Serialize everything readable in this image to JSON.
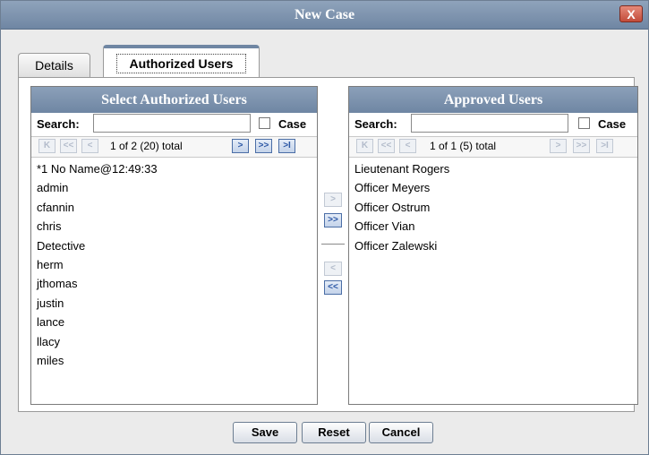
{
  "window": {
    "title": "New Case",
    "close_label": "X"
  },
  "tabs": [
    {
      "label": "Details",
      "active": false
    },
    {
      "label": "Authorized Users",
      "active": true
    }
  ],
  "left_list": {
    "header": "Select Authorized Users",
    "search_label": "Search:",
    "search_value": "",
    "case_label": "Case",
    "case_checked": false,
    "pager_text": "1 of 2 (20) total",
    "items": [
      "*1 No Name@12:49:33",
      "admin",
      "cfannin",
      "chris",
      "Detective",
      "herm",
      "jthomas",
      "justin",
      "lance",
      "llacy",
      "miles"
    ]
  },
  "right_list": {
    "header": "Approved Users",
    "search_label": "Search:",
    "search_value": "",
    "case_label": "Case",
    "case_checked": false,
    "pager_text": "1 of 1 (5) total",
    "items": [
      "Lieutenant Rogers",
      "Officer Meyers",
      "Officer Ostrum",
      "Officer Vian",
      "Officer Zalewski"
    ]
  },
  "pager_icons": {
    "first": "K",
    "prev_page": "<<",
    "prev": "<",
    "next": ">",
    "next_page": ">>",
    "last": ">I"
  },
  "move_icons": {
    "add_one": ">",
    "add_all": ">>",
    "remove_one": "<",
    "remove_all": "<<"
  },
  "buttons": {
    "save": "Save",
    "reset": "Reset",
    "cancel": "Cancel"
  },
  "colors": {
    "header_blue": "#6f86a3",
    "active_arrow": "#2a56a4",
    "close_red": "#c24c3a"
  }
}
